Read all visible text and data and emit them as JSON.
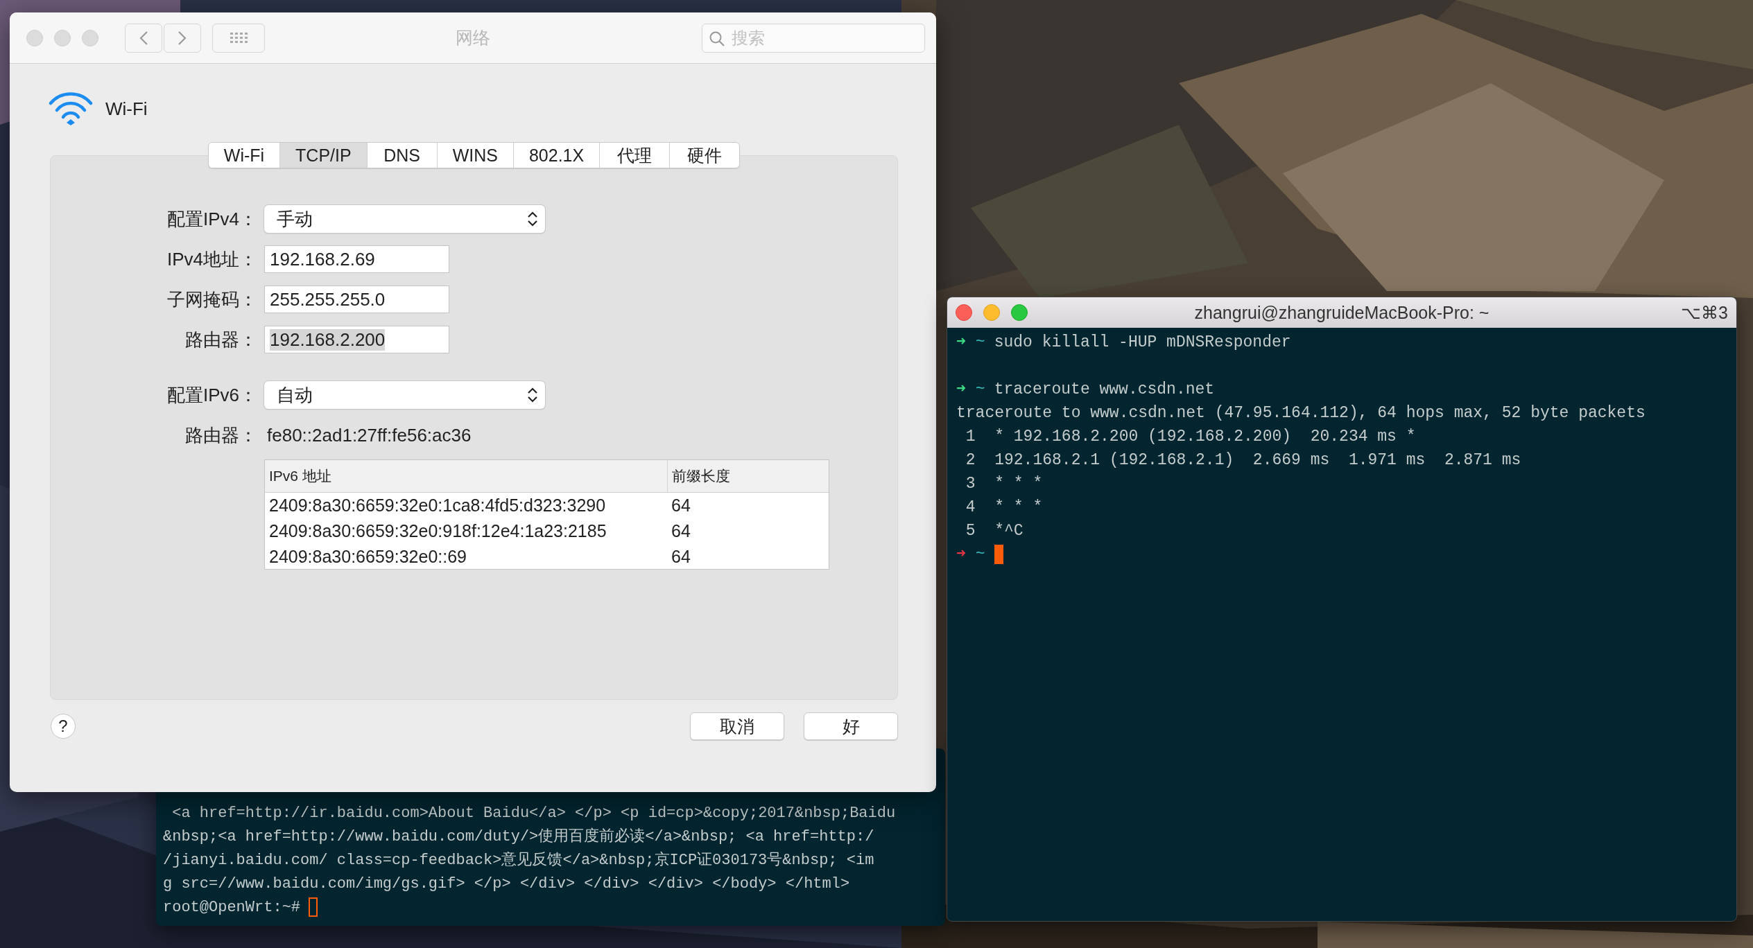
{
  "network_window": {
    "title": "网络",
    "search": {
      "placeholder": "搜索"
    },
    "service": "Wi-Fi",
    "tabs": [
      {
        "label": "Wi-Fi",
        "selected": false
      },
      {
        "label": "TCP/IP",
        "selected": true
      },
      {
        "label": "DNS",
        "selected": false
      },
      {
        "label": "WINS",
        "selected": false
      },
      {
        "label": "802.1X",
        "selected": false
      },
      {
        "label": "代理",
        "selected": false
      },
      {
        "label": "硬件",
        "selected": false
      }
    ],
    "ipv4_rows": [
      {
        "kind": "popup",
        "label": "配置IPv4：",
        "value": "手动"
      },
      {
        "kind": "field",
        "label": "IPv4地址：",
        "value": "192.168.2.69",
        "highlighted": false
      },
      {
        "kind": "field",
        "label": "子网掩码：",
        "value": "255.255.255.0",
        "highlighted": false
      },
      {
        "kind": "field",
        "label": "路由器：",
        "value": "192.168.2.200",
        "highlighted": true
      }
    ],
    "ipv6_rows": [
      {
        "kind": "popup",
        "label": "配置IPv6：",
        "value": "自动"
      },
      {
        "kind": "text",
        "label": "路由器：",
        "value": "fe80::2ad1:27ff:fe56:ac36"
      }
    ],
    "ipv6_table": {
      "columns": [
        "IPv6 地址",
        "前缀长度"
      ],
      "rows": [
        [
          "2409:8a30:6659:32e0:1ca8:4fd5:d323:3290",
          "64"
        ],
        [
          "2409:8a30:6659:32e0:918f:12e4:1a23:2185",
          "64"
        ],
        [
          "2409:8a30:6659:32e0::69",
          "64"
        ]
      ]
    },
    "help": "?",
    "buttons": [
      "取消",
      "好"
    ]
  },
  "back_terminal": {
    "focused": false,
    "output_lines": [
      " <a href=http://ir.baidu.com>About Baidu</a> </p> <p id=cp>&copy;2017&nbsp;Baidu",
      "&nbsp;<a href=http://www.baidu.com/duty/>使用百度前必读</a>&nbsp; <a href=http:/",
      "/jianyi.baidu.com/ class=cp-feedback>意见反馈</a>&nbsp;京ICP证030173号&nbsp; <im",
      "g src=//www.baidu.com/img/gs.gif> </p> </div> </div> </div> </body> </html>"
    ],
    "prompt": {
      "text": "root@OpenWrt:~#",
      "cursor": true
    }
  },
  "terminal": {
    "title": "zhangrui@zhangruideMacBook-Pro: ~",
    "shortcut": "⌥⌘3",
    "focused": true,
    "lines": [
      {
        "kind": "prompt",
        "error": false,
        "arrow": "➜",
        "path": "~",
        "command": "sudo killall -HUP mDNSResponder",
        "cursor": false
      },
      {
        "kind": "blank"
      },
      {
        "kind": "prompt",
        "error": false,
        "arrow": "➜",
        "path": "~",
        "command": "traceroute www.csdn.net",
        "cursor": false
      },
      {
        "kind": "output",
        "text": "traceroute to www.csdn.net (47.95.164.112), 64 hops max, 52 byte packets"
      },
      {
        "kind": "output",
        "text": " 1  * 192.168.2.200 (192.168.2.200)  20.234 ms *"
      },
      {
        "kind": "output",
        "text": " 2  192.168.2.1 (192.168.2.1)  2.669 ms  1.971 ms  2.871 ms"
      },
      {
        "kind": "output",
        "text": " 3  * * *"
      },
      {
        "kind": "output",
        "text": " 4  * * *"
      },
      {
        "kind": "output",
        "text": " 5  *^C"
      },
      {
        "kind": "prompt",
        "error": true,
        "arrow": "➜",
        "path": "~",
        "cursor": true
      }
    ]
  }
}
